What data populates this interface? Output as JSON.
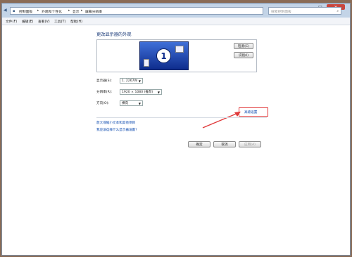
{
  "window": {
    "controls": {
      "minimize": "–",
      "maximize": "□",
      "close": "✕"
    },
    "breadcrumb": [
      "控制面板",
      "外观和个性化",
      "显示",
      "屏幕分辨率"
    ],
    "search_placeholder": "搜索控制面板"
  },
  "menu": [
    "文件(F)",
    "编辑(E)",
    "查看(V)",
    "工具(T)",
    "帮助(H)"
  ],
  "main": {
    "title": "更改显示器的外观",
    "monitor_number": "1",
    "detect_button": "检测(C)",
    "identify_button": "识别(I)",
    "display_label": "显示器(S):",
    "display_value": "1. 2267W",
    "resolution_label": "分辨率(R):",
    "resolution_value": "1920 × 1080 (推荐)",
    "orientation_label": "方向(O):",
    "orientation_value": "横向",
    "advanced_link": "高级设置",
    "link_text_size": "放大或缩小文本和其他项目",
    "link_help": "我应该选择什么显示器设置?"
  },
  "buttons": {
    "ok": "确定",
    "cancel": "取消",
    "apply": "应用(A)"
  },
  "colors": {
    "highlight": "#e0393a",
    "monitor_blue": "#1a3fa0",
    "link": "#0645ad"
  }
}
